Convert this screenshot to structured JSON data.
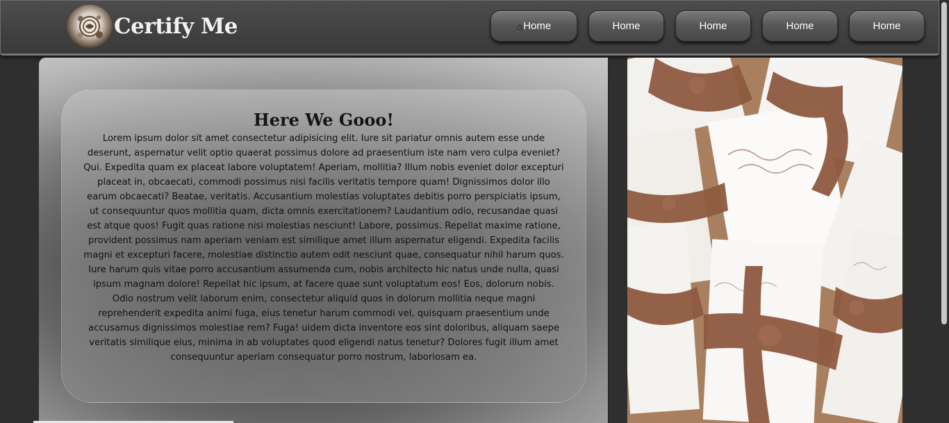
{
  "header": {
    "brand_name": "Certify Me",
    "nav": [
      {
        "label": "Home",
        "icon": "home-icon"
      },
      {
        "label": "Home"
      },
      {
        "label": "Home"
      },
      {
        "label": "Home"
      },
      {
        "label": "Home"
      }
    ]
  },
  "main": {
    "title": "Here We Gooo!",
    "body": "Lorem ipsum dolor sit amet consectetur adipisicing elit. Iure sit pariatur omnis autem esse unde deserunt, aspernatur velit optio quaerat possimus dolore ad praesentium iste nam vero culpa eveniet? Qui. Expedita quam ex placeat labore voluptatem! Aperiam, mollitia? Illum nobis eveniet dolor excepturi placeat in, obcaecati, commodi possimus nisi facilis veritatis tempore quam! Dignissimos dolor illo earum obcaecati? Beatae, veritatis. Accusantium molestias voluptates debitis porro perspiciatis ipsum, ut consequuntur quos mollitia quam, dicta omnis exercitationem? Laudantium odio, recusandae quasi est atque quos! Fugit quas ratione nisi molestias nesciunt! Labore, possimus. Repellat maxime ratione, provident possimus nam aperiam veniam est similique amet illum aspernatur eligendi. Expedita facilis magni et excepturi facere, molestiae distinctio autem odit nesciunt quae, consequatur nihil harum quos. Iure harum quis vitae porro accusantium assumenda cum, nobis architecto hic natus unde nulla, quasi ipsum magnam dolore! Repellat hic ipsum, at facere quae sunt voluptatum eos! Eos, dolorum nobis. Odio nostrum velit laborum enim, consectetur aliquid quos in dolorum mollitia neque magni reprehenderit expedita animi fuga, eius tenetur harum commodi vel, quisquam praesentium unde accusamus dignissimos molestiae rem? Fuga! uidem dicta inventore eos sint doloribus, aliquam saepe veritatis similique eius, minima in ab voluptates quod eligendi natus tenetur? Dolores fugit illum amet consequuntur aperiam consequatur porro nostrum, laboriosam ea."
  }
}
